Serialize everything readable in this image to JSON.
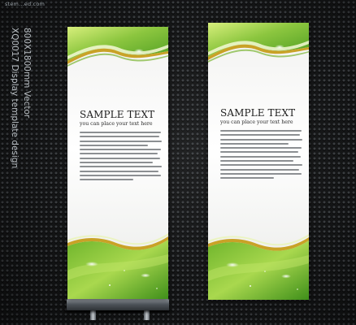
{
  "watermark": "stem…ed.com",
  "side_title": {
    "line1": "XQ0017 Display template design",
    "line2": "800X1800mm Vector"
  },
  "banners": [
    {
      "title": "SAMPLE TEXT",
      "subtitle": "you can place your text here"
    },
    {
      "title": "SAMPLE TEXT",
      "subtitle": "you can place your text here"
    }
  ],
  "colors": {
    "background": "#141516",
    "green_light": "#c9e86a",
    "green_mid": "#8cc63f",
    "green_dark": "#3f8f1a",
    "gold_stripe": "#c9a227",
    "banner_white": "#ffffff",
    "stand_metal": "#8a9096"
  }
}
